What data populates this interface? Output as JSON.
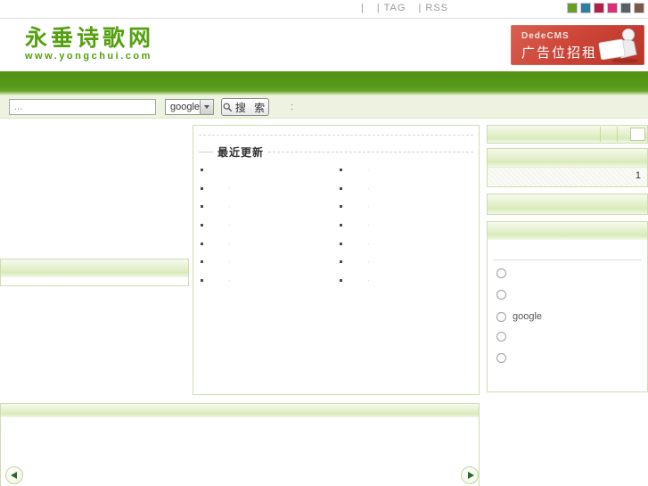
{
  "topbar": {
    "links": [
      {
        "label": "|"
      },
      {
        "label": "| TAG"
      },
      {
        "label": "| RSS"
      }
    ],
    "palette": [
      "#6a9e26",
      "#2f7fa5",
      "#b22045",
      "#dc2f7b",
      "#596066",
      "#7a584a"
    ]
  },
  "header": {
    "logo_title": "永垂诗歌网",
    "logo_subtitle": "www.yongchui.com",
    "ad_banner": {
      "brand": "DedeCMS",
      "text": "广告位招租",
      "bg_color": "#c6402f"
    }
  },
  "search": {
    "input_value": "...",
    "engine_selected": "google",
    "button_label": "搜 索",
    "suffix": ":"
  },
  "main": {
    "recent_updates": {
      "title": "最近更新",
      "items_left": [
        {
          "mark": ""
        },
        {
          "mark": "·"
        },
        {
          "mark": "·"
        },
        {
          "mark": "·"
        },
        {
          "mark": "·"
        },
        {
          "mark": "·"
        },
        {
          "mark": "·"
        }
      ],
      "items_right": [
        {
          "mark": "·"
        },
        {
          "mark": "·"
        },
        {
          "mark": "·"
        },
        {
          "mark": "·"
        },
        {
          "mark": "·"
        },
        {
          "mark": "·"
        },
        {
          "mark": "·"
        }
      ]
    }
  },
  "sidebar": {
    "bar1_input_value": "",
    "stats_value": "1",
    "poll": {
      "options": [
        {
          "label": ""
        },
        {
          "label": ""
        },
        {
          "label": "google"
        },
        {
          "label": ""
        },
        {
          "label": ""
        }
      ]
    }
  },
  "icons": {
    "search": "magnifier",
    "select_arrow": "triangle-down",
    "prev": "triangle-left",
    "next": "triangle-right"
  },
  "colors": {
    "brand_green": "#55a00f",
    "nav_green": "#539212",
    "strip_green": "#eef3e1",
    "box_border": "#cdddb2"
  }
}
